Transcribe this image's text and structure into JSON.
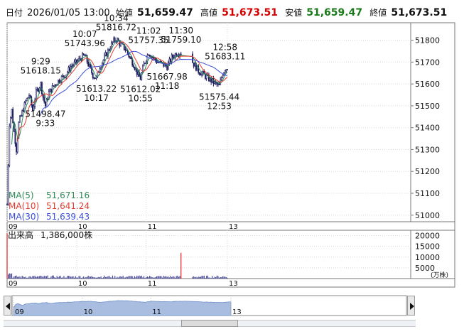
{
  "header": {
    "date_label": "日付",
    "datetime": "2026/01/05 13:00",
    "open_label": "始値",
    "open": "51,659.47",
    "high_label": "高値",
    "high": "51,673.51",
    "low_label": "安値",
    "low": "51,659.47",
    "close_label": "終値",
    "close": "51,673.51"
  },
  "colors": {
    "up_red": "#d40000",
    "down_green": "#1a7a1a",
    "ma5": "#2e8b57",
    "ma10": "#e03c31",
    "ma30": "#3a4fd6",
    "candle": "#1a1a5e",
    "volume": "#4a4a9a",
    "volume_spike": "#e02020",
    "grid": "#d8d8d8",
    "nav_fill": "#a8bde0"
  },
  "ma_legend": [
    {
      "name": "MA(5)",
      "value": "51,671.16",
      "color": "#2e8b57"
    },
    {
      "name": "MA(10)",
      "value": "51,641.24",
      "color": "#e03c31"
    },
    {
      "name": "MA(30)",
      "value": "51,639.43",
      "color": "#3a4fd6"
    }
  ],
  "volume_label": "出来高",
  "volume_value": "1,386,000株",
  "volume_unit": "(万株)",
  "chart_data": [
    {
      "type": "candlestick",
      "x_ticks": [
        "09",
        "10",
        "11",
        "13"
      ],
      "y_ticks": [
        5000,
        5100,
        5200,
        5300,
        5400,
        5500,
        5600,
        5700,
        5800
      ],
      "y_tick_labels": [
        "51000",
        "51100",
        "51200",
        "51300",
        "51400",
        "51500",
        "51600",
        "51700",
        "51800"
      ],
      "ylim": [
        50970,
        51880
      ],
      "session": {
        "start": "09:00",
        "end": "13:00",
        "lunch_start": "11:30",
        "lunch_end": "12:30"
      },
      "annotations": [
        {
          "time": "09:29",
          "value": 51618.15,
          "time_label": "9:29",
          "value_label": "51618.15",
          "pos": "above"
        },
        {
          "time": "09:33",
          "value": 51498.47,
          "time_label": "9:33",
          "value_label": "51498.47",
          "pos": "below"
        },
        {
          "time": "10:07",
          "value": 51743.96,
          "time_label": "10:07",
          "value_label": "51743.96",
          "pos": "above"
        },
        {
          "time": "10:17",
          "value": 51613.22,
          "time_label": "10:17",
          "value_label": "51613.22",
          "pos": "below"
        },
        {
          "time": "10:34",
          "value": 51816.72,
          "time_label": "10:34",
          "value_label": "51816.72",
          "pos": "above"
        },
        {
          "time": "10:55",
          "value": 51612.02,
          "time_label": "10:55",
          "value_label": "51612.02",
          "pos": "below"
        },
        {
          "time": "11:02",
          "value": 51757.35,
          "time_label": "11:02",
          "value_label": "51757.35",
          "pos": "above"
        },
        {
          "time": "11:18",
          "value": 51667.98,
          "time_label": "11:18",
          "value_label": "51667.98",
          "pos": "below"
        },
        {
          "time": "11:30",
          "value": 51759.1,
          "time_label": "11:30",
          "value_label": "51759.10",
          "pos": "above"
        },
        {
          "time": "12:53",
          "value": 51575.44,
          "time_label": "12:53",
          "value_label": "51575.44",
          "pos": "below"
        },
        {
          "time": "12:58",
          "value": 51683.11,
          "time_label": "12:58",
          "value_label": "51683.11",
          "pos": "above"
        }
      ],
      "price_path": [
        [
          "09:00",
          51050
        ],
        [
          "09:02",
          51420
        ],
        [
          "09:04",
          51480
        ],
        [
          "09:06",
          51380
        ],
        [
          "09:08",
          51300
        ],
        [
          "09:10",
          51420
        ],
        [
          "09:13",
          51470
        ],
        [
          "09:16",
          51520
        ],
        [
          "09:19",
          51550
        ],
        [
          "09:22",
          51480
        ],
        [
          "09:25",
          51560
        ],
        [
          "09:29",
          51600
        ],
        [
          "09:31",
          51540
        ],
        [
          "09:33",
          51500
        ],
        [
          "09:36",
          51560
        ],
        [
          "09:40",
          51590
        ],
        [
          "09:45",
          51620
        ],
        [
          "09:50",
          51640
        ],
        [
          "09:55",
          51680
        ],
        [
          "10:00",
          51700
        ],
        [
          "10:04",
          51720
        ],
        [
          "10:07",
          51730
        ],
        [
          "10:10",
          51690
        ],
        [
          "10:14",
          51640
        ],
        [
          "10:17",
          51625
        ],
        [
          "10:20",
          51680
        ],
        [
          "10:24",
          51720
        ],
        [
          "10:28",
          51760
        ],
        [
          "10:31",
          51790
        ],
        [
          "10:34",
          51805
        ],
        [
          "10:38",
          51780
        ],
        [
          "10:42",
          51760
        ],
        [
          "10:46",
          51720
        ],
        [
          "10:50",
          51680
        ],
        [
          "10:53",
          51640
        ],
        [
          "10:55",
          51625
        ],
        [
          "10:58",
          51690
        ],
        [
          "11:02",
          51745
        ],
        [
          "11:06",
          51720
        ],
        [
          "11:10",
          51700
        ],
        [
          "11:14",
          51690
        ],
        [
          "11:18",
          51680
        ],
        [
          "11:22",
          51720
        ],
        [
          "11:26",
          51740
        ],
        [
          "11:30",
          51745
        ],
        [
          "12:30",
          51700
        ],
        [
          "12:35",
          51660
        ],
        [
          "12:40",
          51640
        ],
        [
          "12:45",
          51620
        ],
        [
          "12:50",
          51600
        ],
        [
          "12:53",
          51590
        ],
        [
          "12:56",
          51650
        ],
        [
          "12:58",
          51670
        ],
        [
          "13:00",
          51673.51
        ]
      ]
    },
    {
      "type": "bar",
      "name": "出来高",
      "y_ticks": [
        5000,
        10000,
        15000,
        20000
      ],
      "y_tick_labels": [
        "5000",
        "10000",
        "15000",
        "20000"
      ],
      "ylim": [
        0,
        22500
      ],
      "opening_volume": 21000,
      "typical_volume": 800,
      "spike": {
        "time": "11:30",
        "volume": 12000
      }
    }
  ]
}
